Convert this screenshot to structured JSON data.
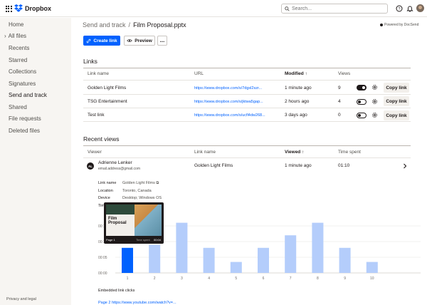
{
  "app": {
    "brand": "Dropbox"
  },
  "search": {
    "placeholder": "Search..."
  },
  "sidebar": {
    "items": [
      {
        "label": "Home"
      },
      {
        "label": "All files"
      },
      {
        "label": "Recents"
      },
      {
        "label": "Starred"
      },
      {
        "label": "Collections"
      },
      {
        "label": "Signatures"
      },
      {
        "label": "Send and track",
        "active": true
      },
      {
        "label": "Shared"
      },
      {
        "label": "File requests"
      },
      {
        "label": "Deleted files"
      }
    ],
    "footer": "Privacy and legal"
  },
  "breadcrumb": {
    "parent": "Send and track",
    "separator": "/",
    "current": "Film Proposal.pptx"
  },
  "powered_by": "Powered by DocSend",
  "actions": {
    "create_link": "Create link",
    "preview": "Preview",
    "more": "..."
  },
  "links": {
    "title": "Links",
    "headers": {
      "name": "Link name",
      "url": "URL",
      "modified": "Modified",
      "views": "Views"
    },
    "rows": [
      {
        "name": "Golden Light Films",
        "url": "https://www.dropbox.com/s/7dgsl2szr...",
        "modified": "1 minute ago",
        "views": "9",
        "enabled": true,
        "copy": "Copy link"
      },
      {
        "name": "TSG Entertainment",
        "url": "https://www.dropbox.com/s/jktwa5gap...",
        "modified": "2 hours ago",
        "views": "4",
        "enabled": false,
        "copy": "Copy link"
      },
      {
        "name": "Test link",
        "url": "https://www.dropbox.com/s/ucfl4dw268...",
        "modified": "3 days ago",
        "views": "0",
        "enabled": false,
        "copy": "Copy link"
      }
    ]
  },
  "recent_views": {
    "title": "Recent views",
    "headers": {
      "viewer": "Viewer",
      "link_name": "Link name",
      "viewed": "Viewed",
      "time_spent": "Time spent"
    },
    "row": {
      "initials": "AL",
      "name": "Adrienne Lenker",
      "email": "email.address@gmail.com",
      "link_name": "Golden Light Films",
      "viewed": "1 minute ago",
      "time_spent": "01:10"
    },
    "details": {
      "link_name_label": "Link name",
      "link_name_value": "Golden Light Films",
      "location_label": "Location",
      "location_value": "Toronto, Canada",
      "device_label": "Device",
      "device_value": "Desktop; Windows OS",
      "time_label_partial": "Tim"
    },
    "embedded_label": "Embedded link clicks",
    "embedded_partial": "Page 2    https://www.youtube.com/watch?v=..."
  },
  "thumbnail": {
    "title_line1": "Film",
    "title_line2": "Proposal",
    "page": "Page 1",
    "time_label": "Time spent",
    "time_value": "00:04"
  },
  "chart_data": {
    "type": "bar",
    "categories": [
      "1",
      "2",
      "3",
      "4",
      "5",
      "6",
      "7",
      "8",
      "9",
      "10"
    ],
    "values": [
      8,
      9,
      16,
      8,
      3.5,
      8,
      12,
      16,
      8,
      3.5
    ],
    "highlighted_index": 0,
    "y_tick_labels": [
      "00:00",
      "00:05",
      "00:10",
      "00:15"
    ],
    "ylim": [
      0,
      20
    ],
    "colors": {
      "highlight": "#0061fe",
      "bar": "#b4cdfb"
    }
  }
}
